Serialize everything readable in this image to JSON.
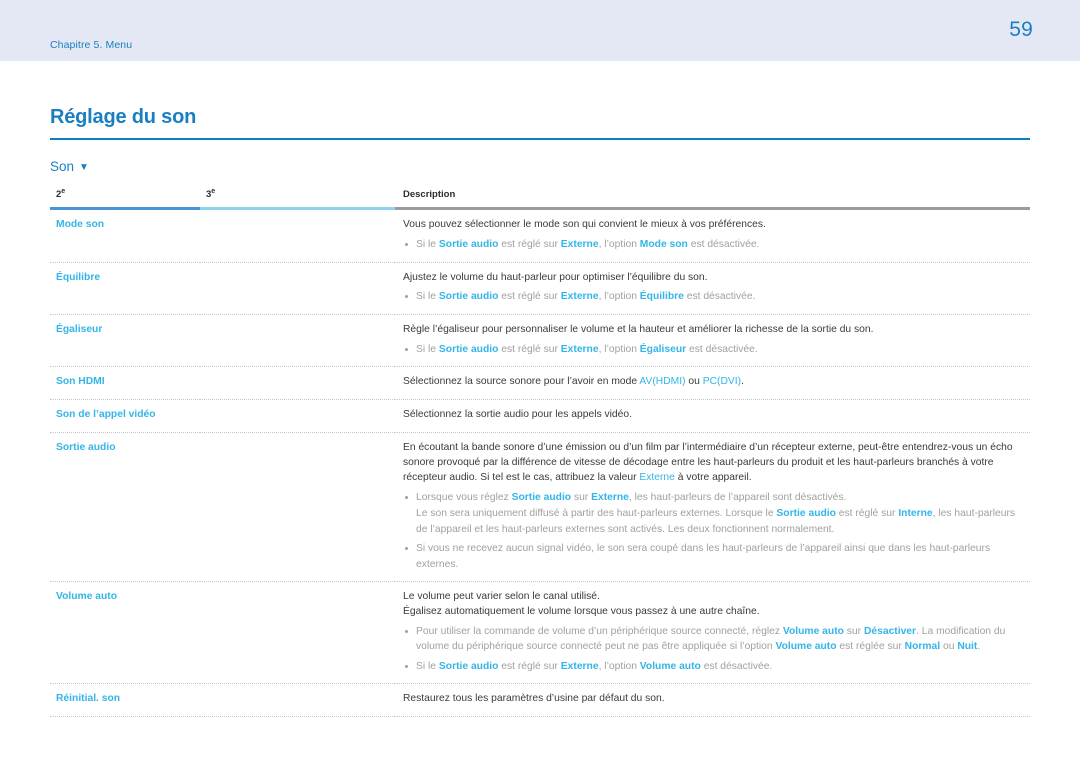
{
  "banner": {
    "chapter": "Chapitre 5. Menu",
    "page_number": "59",
    "background": "#e4e8f5",
    "text_color": "#1a7fc1"
  },
  "document": {
    "title": "Réglage du son",
    "section": {
      "label": "Son",
      "caret_icon": "chevron-down-icon"
    }
  },
  "table": {
    "headers": {
      "col1": "2",
      "col1_sup": "e",
      "col2": "3",
      "col2_sup": "e",
      "col3": "Description"
    },
    "rule_colors": {
      "col1": "#4a93d9",
      "col2": "#8ed4ef",
      "col3": "#9b9b9b"
    },
    "rows": [
      {
        "label": "Mode son",
        "lines": [
          "Vous pouvez sélectionner le mode son qui convient le mieux à vos préférences."
        ],
        "notes": [
          {
            "parts": [
              {
                "t": "Si le ",
                "s": "plain"
              },
              {
                "t": "Sortie audio",
                "s": "hl"
              },
              {
                "t": " est réglé sur ",
                "s": "plain"
              },
              {
                "t": "Externe",
                "s": "hl"
              },
              {
                "t": ", l’option ",
                "s": "plain"
              },
              {
                "t": "Mode son",
                "s": "hl"
              },
              {
                "t": " est désactivée.",
                "s": "plain"
              }
            ]
          }
        ]
      },
      {
        "label": "Équilibre",
        "lines": [
          "Ajustez le volume du haut-parleur pour optimiser l’équilibre du son."
        ],
        "notes": [
          {
            "parts": [
              {
                "t": "Si le ",
                "s": "plain"
              },
              {
                "t": "Sortie audio",
                "s": "hl"
              },
              {
                "t": " est réglé sur ",
                "s": "plain"
              },
              {
                "t": "Externe",
                "s": "hl"
              },
              {
                "t": ", l’option ",
                "s": "plain"
              },
              {
                "t": "Équilibre",
                "s": "hl"
              },
              {
                "t": " est désactivée.",
                "s": "plain"
              }
            ]
          }
        ]
      },
      {
        "label": "Égaliseur",
        "lines": [
          "Règle l’égaliseur pour personnaliser le volume et la hauteur et améliorer la richesse de la sortie du son."
        ],
        "notes": [
          {
            "parts": [
              {
                "t": "Si le ",
                "s": "plain"
              },
              {
                "t": "Sortie audio",
                "s": "hl"
              },
              {
                "t": " est réglé sur ",
                "s": "plain"
              },
              {
                "t": "Externe",
                "s": "hl"
              },
              {
                "t": ", l’option ",
                "s": "plain"
              },
              {
                "t": "Égaliseur",
                "s": "hl"
              },
              {
                "t": " est désactivée.",
                "s": "plain"
              }
            ]
          }
        ]
      },
      {
        "label": "Son HDMI",
        "rich_lines": [
          [
            {
              "t": "Sélectionnez la source sonore pour l’avoir en mode ",
              "s": "plain"
            },
            {
              "t": "AV(HDMI)",
              "s": "hl-plain"
            },
            {
              "t": " ou ",
              "s": "plain"
            },
            {
              "t": "PC(DVI)",
              "s": "hl-plain"
            },
            {
              "t": ".",
              "s": "plain"
            }
          ]
        ],
        "notes": []
      },
      {
        "label": "Son de l’appel vidéo",
        "lines": [
          "Sélectionnez la sortie audio pour les appels vidéo."
        ],
        "notes": []
      },
      {
        "label": "Sortie audio",
        "rich_lines": [
          [
            {
              "t": "En écoutant la bande sonore d’une émission ou d’un film par l’intermédiaire d’un récepteur externe, peut-être entendrez-vous un écho sonore provoqué par la différence de vitesse de décodage entre les haut-parleurs du produit et les haut-parleurs branchés à votre récepteur audio. Si tel est le cas, attribuez la valeur ",
              "s": "plain"
            },
            {
              "t": "Externe",
              "s": "hl-plain"
            },
            {
              "t": " à votre appareil.",
              "s": "plain"
            }
          ]
        ],
        "notes": [
          {
            "parts": [
              {
                "t": "Lorsque vous réglez ",
                "s": "plain"
              },
              {
                "t": "Sortie audio",
                "s": "hl"
              },
              {
                "t": " sur ",
                "s": "plain"
              },
              {
                "t": "Externe",
                "s": "hl"
              },
              {
                "t": ", les haut-parleurs de l’appareil sont désactivés.",
                "s": "plain"
              }
            ],
            "sub_parts": [
              {
                "t": "Le son sera uniquement diffusé à partir des haut-parleurs externes. Lorsque le ",
                "s": "plain"
              },
              {
                "t": "Sortie audio",
                "s": "hl"
              },
              {
                "t": " est réglé sur ",
                "s": "plain"
              },
              {
                "t": "Interne",
                "s": "hl"
              },
              {
                "t": ", les haut-parleurs de l’appareil et les haut-parleurs externes sont activés. Les deux fonctionnent normalement.",
                "s": "plain"
              }
            ]
          },
          {
            "parts": [
              {
                "t": "Si vous ne recevez aucun signal vidéo, le son sera coupé dans les haut-parleurs de l’appareil ainsi que dans les haut-parleurs externes.",
                "s": "plain"
              }
            ]
          }
        ]
      },
      {
        "label": "Volume auto",
        "lines": [
          "Le volume peut varier selon le canal utilisé.",
          "Égalisez automatiquement le volume lorsque vous passez à une autre chaîne."
        ],
        "notes": [
          {
            "parts": [
              {
                "t": "Pour utiliser la commande de volume d’un périphérique source connecté, réglez ",
                "s": "plain"
              },
              {
                "t": "Volume auto",
                "s": "hl"
              },
              {
                "t": " sur ",
                "s": "plain"
              },
              {
                "t": "Désactiver",
                "s": "hl"
              },
              {
                "t": ". La modification du volume du périphérique source connecté peut ne pas être appliquée si l’option ",
                "s": "plain"
              },
              {
                "t": "Volume auto",
                "s": "hl"
              },
              {
                "t": " est réglée sur ",
                "s": "plain"
              },
              {
                "t": "Normal",
                "s": "hl"
              },
              {
                "t": " ou ",
                "s": "plain"
              },
              {
                "t": "Nuit",
                "s": "hl"
              },
              {
                "t": ".",
                "s": "plain"
              }
            ]
          },
          {
            "parts": [
              {
                "t": "Si le ",
                "s": "plain"
              },
              {
                "t": "Sortie audio",
                "s": "hl"
              },
              {
                "t": " est réglé sur ",
                "s": "plain"
              },
              {
                "t": "Externe",
                "s": "hl"
              },
              {
                "t": ", l’option ",
                "s": "plain"
              },
              {
                "t": "Volume auto",
                "s": "hl"
              },
              {
                "t": " est désactivée.",
                "s": "plain"
              }
            ]
          }
        ]
      },
      {
        "label": "Réinitial. son",
        "lines": [
          "Restaurez tous les paramètres d’usine par défaut du son."
        ],
        "notes": []
      }
    ]
  }
}
